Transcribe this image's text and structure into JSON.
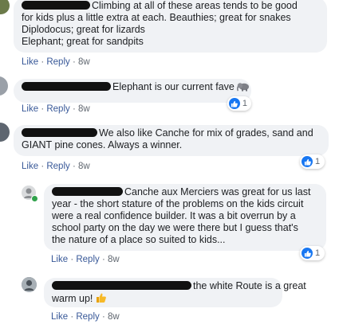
{
  "comments": [
    {
      "lines": [
        "Climbing at all of these areas tends to be good",
        "for kids plus a little extra at each. Beauthies; great for snakes",
        "Diplodocus; great for lizards",
        "Elephant; great for sandpits"
      ],
      "actions": {
        "like": "Like",
        "sep": "·",
        "reply": "Reply",
        "time": "8w"
      }
    },
    {
      "lines": [
        "Elephant is our current fave"
      ],
      "emoji": "elephant-emoji",
      "reaction_count": "1",
      "actions": {
        "like": "Like",
        "sep": "·",
        "reply": "Reply",
        "time": "8w"
      }
    },
    {
      "lines": [
        "We also like Canche for mix of grades, sand and",
        "GIANT pine cones. Always a winner."
      ],
      "reaction_count": "1",
      "actions": {
        "like": "Like",
        "sep": "·",
        "reply": "Reply",
        "time": "8w"
      }
    },
    {
      "lines": [
        "Canche aux Merciers was great for us last",
        "year - the short stature of the problems on the kids circuit",
        "were a real confidence builder. It was a bit overrun by a",
        "school party on the day we were there but I guess that's",
        "the nature of a place so suited to kids..."
      ],
      "reaction_count": "1",
      "actions": {
        "like": "Like",
        "sep": "·",
        "reply": "Reply",
        "time": "8w"
      }
    },
    {
      "lines": [
        "the white Route is a great",
        "warm up!"
      ],
      "emoji": "thumbs-up-emoji",
      "actions": {
        "like": "Like",
        "sep": "·",
        "reply": "Reply",
        "time": "8w"
      }
    }
  ],
  "colors": {
    "link": "#385898",
    "bubble": "#f0f2f5",
    "like_badge": "#1877f2",
    "online": "#31a24c"
  }
}
